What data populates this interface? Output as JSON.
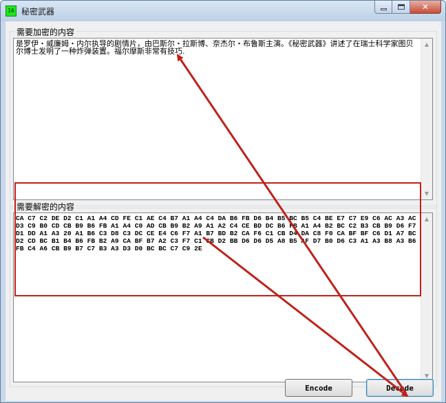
{
  "window": {
    "title": "秘密武器",
    "icon_text": "16"
  },
  "encrypt_group": {
    "label": "需要加密的内容",
    "text": "是罗伊・威廉姆・内尔执导的剧情片，由巴斯尔・拉斯博、奈杰尔・布鲁斯主演。《秘密武器》讲述了在瑞士科学家图贝尔博士发明了一种炸弹装置。福尔摩斯非常有技巧."
  },
  "decrypt_group": {
    "label": "需要解密的内容",
    "text": "CA C7 C2 DE D2 C1 A1 A4 CD FE C1 AE C4 B7 A1 A4 C4 DA B6 FB D6 B4 B5 BC B5 C4 BE E7 C7 E9 C6 AC A3 AC D3 C9 B0 CD CB B9 B6 FB A1 A4 C0 AD CB B9 B2 A9 A1 A2 C4 CE BD DC B6 FB A1 A4 B2 BC C2 B3 CB B9 D6 F7 D1 DD A1 A3 20 A1 B6 C3 D8 C3 DC CE E4 C6 F7 A1 B7 BD B2 CA F6 C1 CB D4 DA C8 F0 CA BF BF C6 D1 A7 BC D2 CD BC B1 B4 B6 FB B2 A9 CA BF B7 A2 C3 F7 C1 CB D2 BB D6 D6 D5 A8 B5 AF D7 B0 D6 C3 A1 A3 B8 A3 B6 FB C4 A6 CB B9 B7 C7 B3 A3 D3 D0 BC BC C7 C9 2E"
  },
  "buttons": {
    "encode": "Encode",
    "decode": "Decode"
  },
  "annotation": {
    "color": "#c0201a"
  }
}
